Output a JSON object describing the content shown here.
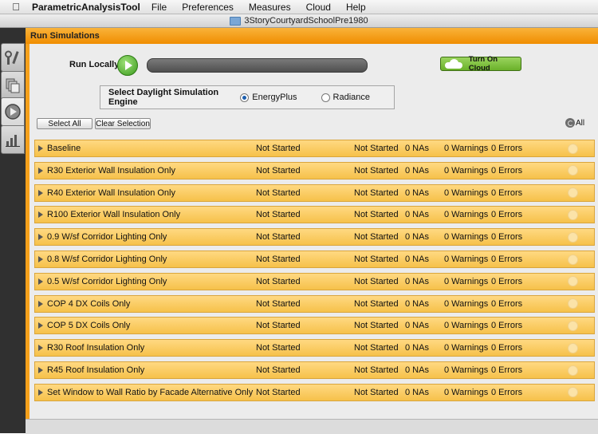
{
  "menubar": {
    "app_name": "ParametricAnalysisTool",
    "items": [
      "File",
      "Preferences",
      "Measures",
      "Cloud",
      "Help"
    ]
  },
  "window": {
    "title": "3StoryCourtyardSchoolPre1980"
  },
  "header": {
    "title": "Run Simulations"
  },
  "run": {
    "label": "Run Locally",
    "cloud_button": "Turn On Cloud"
  },
  "engine": {
    "label": "Select Daylight Simulation Engine",
    "options": [
      {
        "label": "EnergyPlus",
        "selected": true
      },
      {
        "label": "Radiance",
        "selected": false
      }
    ]
  },
  "toolbar": {
    "select_all": "Select All",
    "clear_selection": "Clear Selection",
    "all_label": "All"
  },
  "rows": [
    {
      "name": "Baseline",
      "status1": "Not Started",
      "status2": "Not Started",
      "nas": "0 NAs",
      "warnings": "0 Warnings",
      "errors": "0 Errors"
    },
    {
      "name": "R30 Exterior Wall Insulation Only",
      "status1": "Not Started",
      "status2": "Not Started",
      "nas": "0 NAs",
      "warnings": "0 Warnings",
      "errors": "0 Errors"
    },
    {
      "name": "R40 Exterior Wall Insulation Only",
      "status1": "Not Started",
      "status2": "Not Started",
      "nas": "0 NAs",
      "warnings": "0 Warnings",
      "errors": "0 Errors"
    },
    {
      "name": "R100 Exterior Wall Insulation Only",
      "status1": "Not Started",
      "status2": "Not Started",
      "nas": "0 NAs",
      "warnings": "0 Warnings",
      "errors": "0 Errors"
    },
    {
      "name": "0.9 W/sf Corridor Lighting Only",
      "status1": "Not Started",
      "status2": "Not Started",
      "nas": "0 NAs",
      "warnings": "0 Warnings",
      "errors": "0 Errors"
    },
    {
      "name": "0.8 W/sf Corridor Lighting Only",
      "status1": "Not Started",
      "status2": "Not Started",
      "nas": "0 NAs",
      "warnings": "0 Warnings",
      "errors": "0 Errors"
    },
    {
      "name": "0.5 W/sf Corridor Lighting Only",
      "status1": "Not Started",
      "status2": "Not Started",
      "nas": "0 NAs",
      "warnings": "0 Warnings",
      "errors": "0 Errors"
    },
    {
      "name": "COP 4 DX Coils Only",
      "status1": "Not Started",
      "status2": "Not Started",
      "nas": "0 NAs",
      "warnings": "0 Warnings",
      "errors": "0 Errors"
    },
    {
      "name": "COP 5 DX Coils Only",
      "status1": "Not Started",
      "status2": "Not Started",
      "nas": "0 NAs",
      "warnings": "0 Warnings",
      "errors": "0 Errors"
    },
    {
      "name": "R30 Roof Insulation Only",
      "status1": "Not Started",
      "status2": "Not Started",
      "nas": "0 NAs",
      "warnings": "0 Warnings",
      "errors": "0 Errors"
    },
    {
      "name": "R45 Roof Insulation Only",
      "status1": "Not Started",
      "status2": "Not Started",
      "nas": "0 NAs",
      "warnings": "0 Warnings",
      "errors": "0 Errors"
    },
    {
      "name": "Set Window to Wall Ratio by Facade Alternative Only",
      "status1": "Not Started",
      "status2": "Not Started",
      "nas": "0 NAs",
      "warnings": "0 Warnings",
      "errors": "0 Errors"
    }
  ]
}
